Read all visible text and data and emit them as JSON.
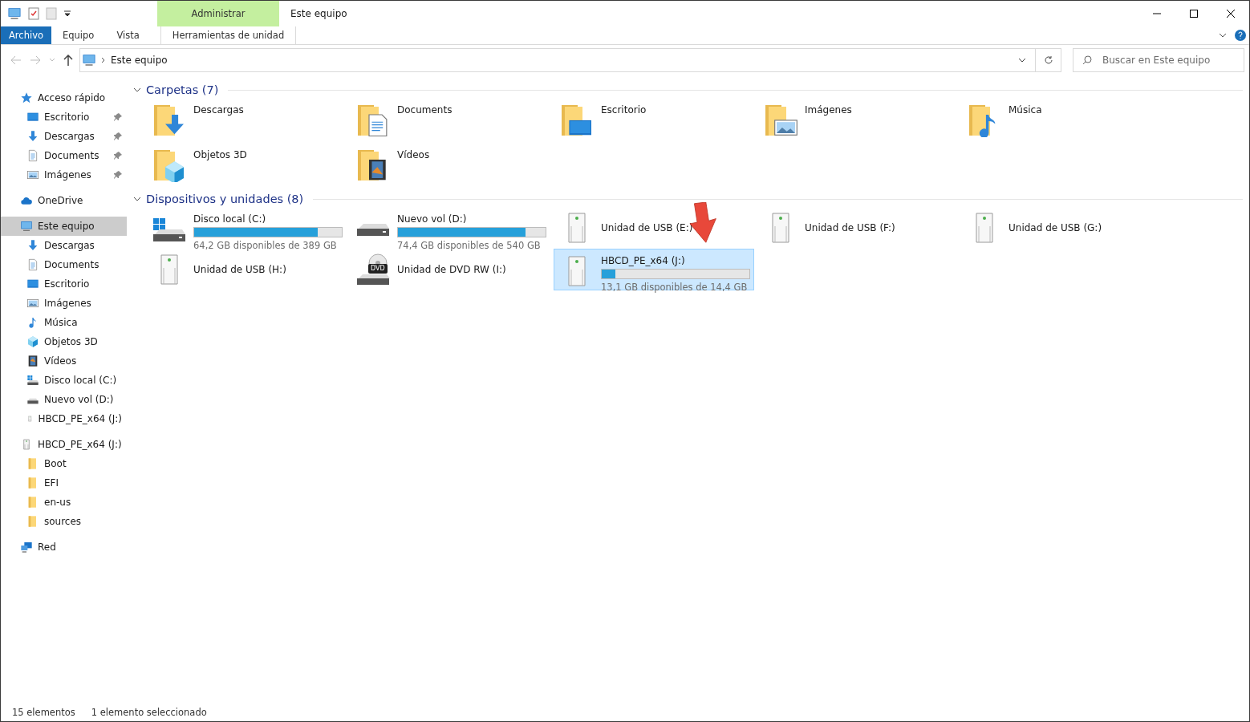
{
  "window": {
    "title": "Este equipo",
    "context_tab": "Administrar"
  },
  "ribbon_tabs": [
    {
      "label": "Archivo",
      "kind": "file"
    },
    {
      "label": "Equipo",
      "kind": "tab"
    },
    {
      "label": "Vista",
      "kind": "tab"
    },
    {
      "label": "Herramientas de unidad",
      "kind": "context"
    }
  ],
  "address": {
    "path": "Este equipo",
    "search_placeholder": "Buscar en Este equipo"
  },
  "sidebar": [
    {
      "label": "Acceso rápido",
      "kind": "star",
      "selected": false,
      "children": [
        {
          "label": "Escritorio",
          "kind": "desktop",
          "pinned": true,
          "selected": false
        },
        {
          "label": "Descargas",
          "kind": "download",
          "pinned": true,
          "selected": false
        },
        {
          "label": "Documents",
          "kind": "document",
          "pinned": true,
          "selected": false
        },
        {
          "label": "Imágenes",
          "kind": "image",
          "pinned": true,
          "selected": false
        }
      ]
    },
    {
      "label": "OneDrive",
      "kind": "cloud",
      "selected": false
    },
    {
      "label": "Este equipo",
      "kind": "computer",
      "selected": true,
      "children": [
        {
          "label": "Descargas",
          "kind": "download",
          "pinned": false,
          "selected": false
        },
        {
          "label": "Documents",
          "kind": "document",
          "pinned": false,
          "selected": false
        },
        {
          "label": "Escritorio",
          "kind": "desktop",
          "pinned": false,
          "selected": false
        },
        {
          "label": "Imágenes",
          "kind": "image",
          "pinned": false,
          "selected": false
        },
        {
          "label": "Música",
          "kind": "music",
          "pinned": false,
          "selected": false
        },
        {
          "label": "Objetos 3D",
          "kind": "cube",
          "pinned": false,
          "selected": false
        },
        {
          "label": "Vídeos",
          "kind": "film",
          "pinned": false,
          "selected": false
        },
        {
          "label": "Disco local (C:)",
          "kind": "windisk",
          "pinned": false,
          "selected": false
        },
        {
          "label": "Nuevo vol (D:)",
          "kind": "disk",
          "pinned": false,
          "selected": false
        },
        {
          "label": "HBCD_PE_x64 (J:)",
          "kind": "usb",
          "pinned": false,
          "selected": false
        }
      ]
    },
    {
      "label": "HBCD_PE_x64 (J:)",
      "kind": "usb",
      "selected": false,
      "children": [
        {
          "label": "Boot",
          "kind": "folder",
          "pinned": false,
          "selected": false
        },
        {
          "label": "EFI",
          "kind": "folder",
          "pinned": false,
          "selected": false
        },
        {
          "label": "en-us",
          "kind": "folder",
          "pinned": false,
          "selected": false
        },
        {
          "label": "sources",
          "kind": "folder",
          "pinned": false,
          "selected": false
        }
      ]
    },
    {
      "label": "Red",
      "kind": "network",
      "selected": false
    }
  ],
  "folders": {
    "title": "Carpetas (7)",
    "expanded": true,
    "items": [
      {
        "label": "Descargas",
        "kind": "download"
      },
      {
        "label": "Documents",
        "kind": "document"
      },
      {
        "label": "Escritorio",
        "kind": "desktop"
      },
      {
        "label": "Imágenes",
        "kind": "image"
      },
      {
        "label": "Música",
        "kind": "music"
      },
      {
        "label": "Objetos 3D",
        "kind": "cube"
      },
      {
        "label": "Vídeos",
        "kind": "film"
      }
    ]
  },
  "drives": {
    "title": "Dispositivos y unidades (8)",
    "expanded": true,
    "items": [
      {
        "label": "Disco local (C:)",
        "kind": "windisk",
        "level": 0.835,
        "free": "64,2 GB disponibles de 389 GB",
        "selected": false
      },
      {
        "label": "Nuevo vol (D:)",
        "kind": "disk",
        "level": 0.862,
        "free": "74,4 GB disponibles de 540 GB",
        "selected": false
      },
      {
        "label": "Unidad de USB (E:)",
        "kind": "usb",
        "selected": false
      },
      {
        "label": "Unidad de USB (F:)",
        "kind": "usb",
        "selected": false
      },
      {
        "label": "Unidad de USB (G:)",
        "kind": "usb",
        "selected": false
      },
      {
        "label": "Unidad de USB (H:)",
        "kind": "usb",
        "selected": false
      },
      {
        "label": "Unidad de DVD RW (I:)",
        "kind": "dvd",
        "badge": "DVD",
        "selected": false
      },
      {
        "label": "HBCD_PE_x64 (J:)",
        "kind": "usb",
        "level": 0.09,
        "free": "13,1 GB disponibles de 14,4 GB",
        "selected": true
      }
    ]
  },
  "status_bar": {
    "count": "15 elementos",
    "selection": "1 elemento seleccionado"
  }
}
